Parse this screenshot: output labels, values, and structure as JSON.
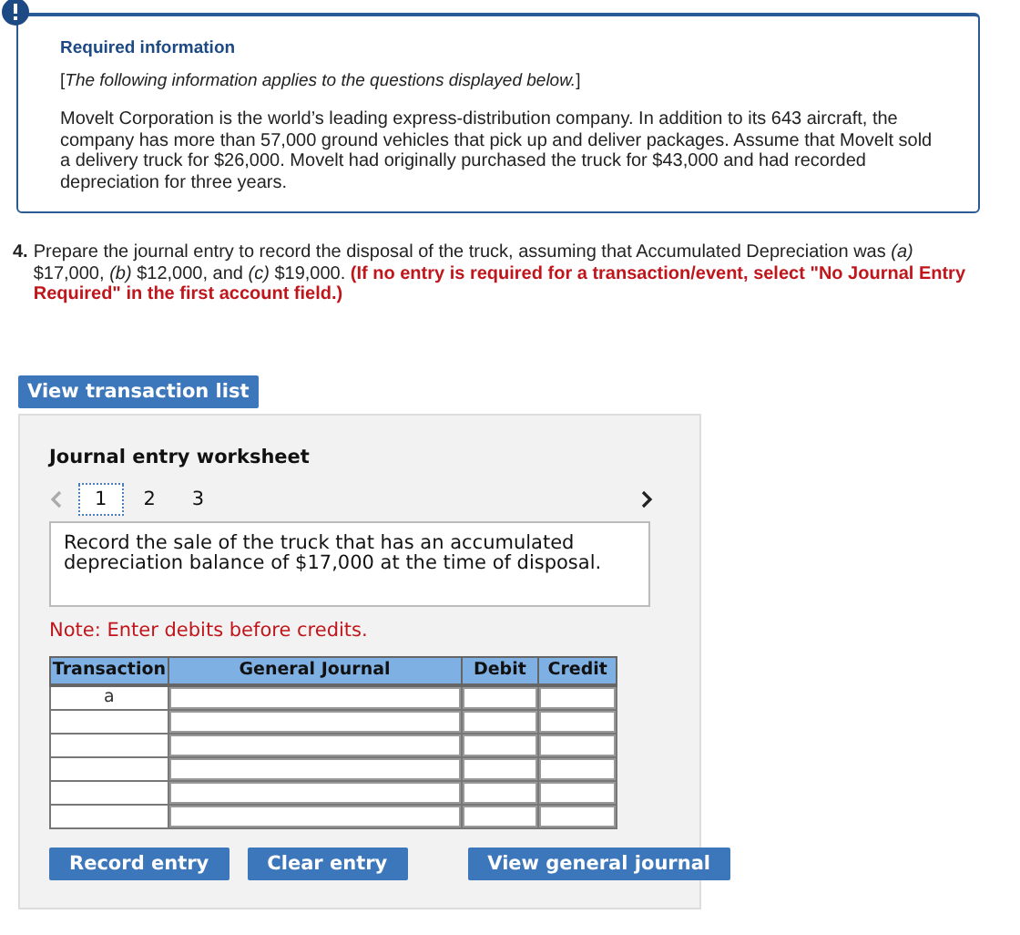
{
  "info": {
    "title": "Required information",
    "intro": "*The following information applies to the questions displayed below.*",
    "bracket_open": "[",
    "bracket_close": "]",
    "body": "Movelt Corporation is the world’s leading express-distribution company. In addition to its 643 aircraft, the company has more than 57,000 ground vehicles that pick up and deliver packages. Assume that Movelt sold a delivery truck for $26,000. Movelt had originally purchased the truck for $43,000 and had recorded depreciation for three years."
  },
  "question": {
    "number": "4.",
    "text": "Prepare the journal entry to record the disposal of the truck, assuming that Accumulated Depreciation was *(a)* $17,000, *(b)* $12,000, and *(c)* $19,000.",
    "note": "(If no entry is required for a transaction/event, select \"No Journal Entry Required\" in the first account field.)"
  },
  "view_list_button": "View transaction list",
  "worksheet": {
    "title": "Journal entry worksheet",
    "prev": {
      "disabled": true
    },
    "next": {
      "disabled": false
    },
    "pages": [
      {
        "label": "1",
        "selected": true
      },
      {
        "label": "2",
        "selected": false
      },
      {
        "label": "3",
        "selected": false
      }
    ],
    "description": "Record the sale of the truck that has an accumulated depreciation balance of $17,000 at the time of disposal.",
    "note": "Note: Enter debits before credits.",
    "columns": [
      "Transaction",
      "General Journal",
      "Debit",
      "Credit"
    ],
    "rows": [
      {
        "transaction": "a"
      },
      {},
      {},
      {},
      {},
      {}
    ],
    "buttons": [
      "Record entry",
      "Clear entry",
      "View general journal"
    ]
  }
}
